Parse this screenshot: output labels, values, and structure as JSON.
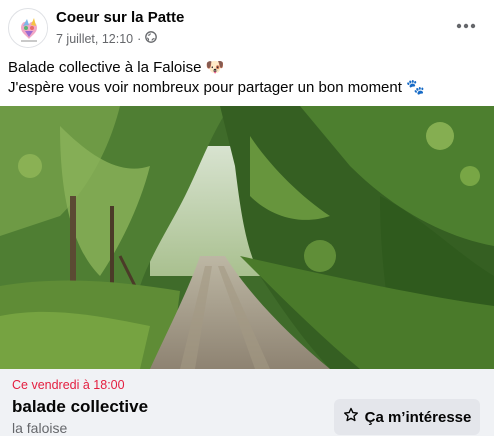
{
  "post": {
    "page_name": "Coeur sur la Patte",
    "timestamp": "7 juillet, 12:10",
    "audience_icon": "globe-icon",
    "more_icon": "more-options-icon",
    "text_line1": "Balade collective à la Faloise",
    "text_line2": "J'espère vous voir nombreux pour partager un bon moment",
    "emoji_line1": "🐶",
    "emoji_line2": "🐾"
  },
  "event": {
    "date_label": "Ce vendredi à 18:00",
    "title": "balade collective",
    "location": "la faloise",
    "interest_label": "Ça m’intéresse",
    "interest_icon": "star-icon"
  },
  "colors": {
    "date_red": "#e41e3f",
    "secondary_text": "#65676b",
    "card_bg": "#f0f2f5",
    "button_bg": "#e4e6eb"
  }
}
